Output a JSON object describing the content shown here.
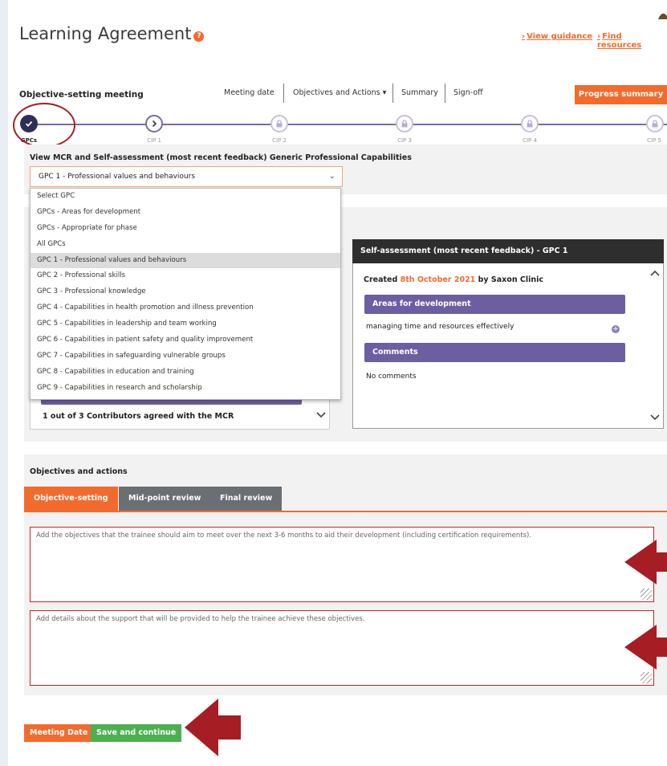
{
  "header": {
    "title": "Learning Agreement",
    "help_glyph": "?",
    "link_guidance": "View guidance",
    "link_resources": "Find resources",
    "link_arrow": "›"
  },
  "nav": {
    "section_title": "Objective-setting meeting",
    "items": [
      "Meeting date",
      "Objectives and Actions",
      "Summary",
      "Sign-off"
    ],
    "dropdown_caret": "▾",
    "progress_button": "Progress summary"
  },
  "steps": [
    {
      "label": "GPCs",
      "state": "done"
    },
    {
      "label": "CIP 1",
      "state": "current"
    },
    {
      "label": "CIP 2",
      "state": "locked"
    },
    {
      "label": "CIP 3",
      "state": "locked"
    },
    {
      "label": "CIP 4",
      "state": "locked"
    },
    {
      "label": "CIP 5",
      "state": "locked"
    }
  ],
  "gpc_view": {
    "heading": "View MCR and Self-assessment (most recent feedback) Generic Professional Capabilities",
    "selected": "GPC 1 - Professional values and behaviours",
    "options": [
      "Select GPC",
      "GPCs - Areas for development",
      "GPCs - Appropriate for phase",
      "All GPCs",
      "GPC 1 - Professional values and behaviours",
      "GPC 2 - Professional skills",
      "GPC 3 - Professional knowledge",
      "GPC 4 - Capabilities in health promotion and illness prevention",
      "GPC 5 - Capabilities in leadership and team working",
      "GPC 6 - Capabilities in patient safety and quality improvement",
      "GPC 7 - Capabilities in safeguarding vulnerable groups",
      "GPC 8 - Capabilities in education and training",
      "GPC 9 - Capabilities in research and scholarship"
    ],
    "selected_index": 4,
    "contributors_text": "1 out of 3 Contributors agreed with the MCR"
  },
  "self_assessment": {
    "heading": "Self-assessment (most recent feedback) - GPC 1",
    "created_prefix": "Created",
    "created_date": "8th October 2021",
    "created_suffix": "by Saxon Clinic",
    "areas_heading": "Areas for development",
    "area_item": "managing time and resources effectively",
    "comments_heading": "Comments",
    "comments_text": "No comments"
  },
  "objectives": {
    "heading": "Objectives and actions",
    "tabs": [
      "Objective-setting",
      "Mid-point review",
      "Final review"
    ],
    "objectives_placeholder": "Add the objectives that the trainee should aim to meet over the next 3-6 months to aid their development (including certification requirements).",
    "support_placeholder": "Add details about the support that will be provided to help the trainee achieve these objectives."
  },
  "footer": {
    "meeting_date_button": "Meeting Date",
    "save_button": "Save and continue"
  },
  "colors": {
    "accent_orange": "#f26b2d",
    "purple": "#6d5ea2",
    "dark_navy": "#2e2f56",
    "annotation_red": "#a61d24",
    "save_green": "#4caf50"
  },
  "icons": {
    "check": "check-icon",
    "chevron_right": "chevron-right-icon",
    "lock": "lock-icon",
    "chevron_down": "chevron-down-icon",
    "chevron_up": "chevron-up-icon",
    "plus": "plus-circle-icon"
  }
}
